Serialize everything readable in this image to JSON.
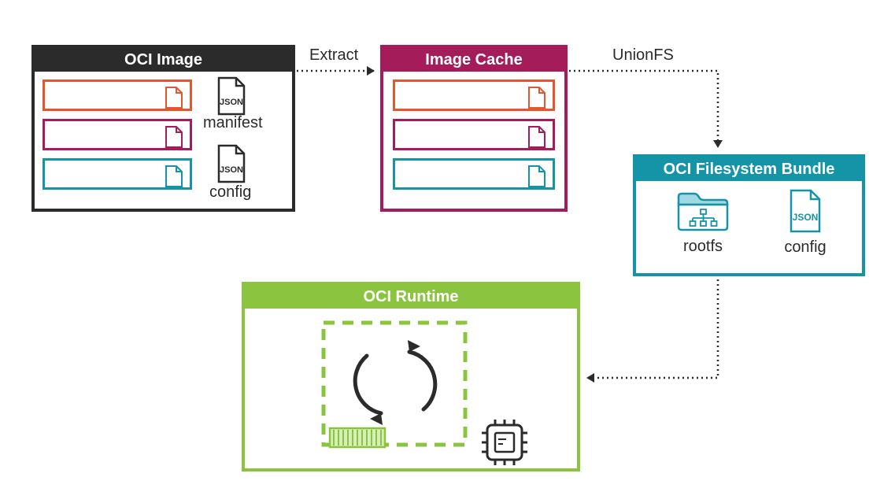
{
  "diagram": {
    "oci_image": {
      "title": "OCI Image",
      "manifest_label": "manifest",
      "config_label": "config"
    },
    "image_cache": {
      "title": "Image Cache"
    },
    "fs_bundle": {
      "title": "OCI Filesystem Bundle",
      "rootfs_label": "rootfs",
      "config_label": "config"
    },
    "runtime": {
      "title": "OCI Runtime"
    },
    "arrows": {
      "extract": "Extract",
      "unionfs": "UnionFS"
    }
  }
}
